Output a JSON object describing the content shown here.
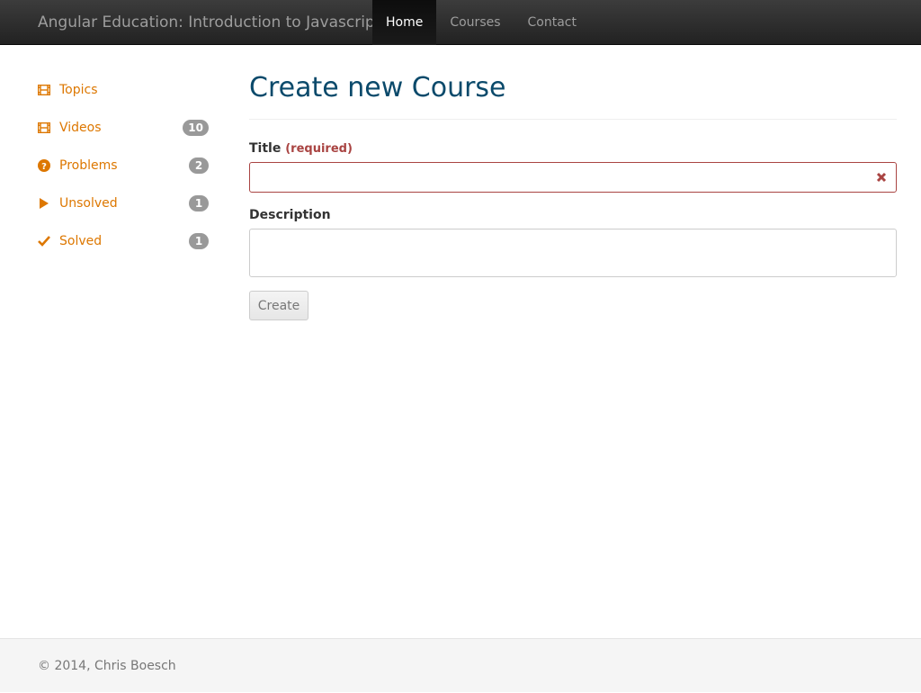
{
  "navbar": {
    "brand": "Angular Education: Introduction to Javascript",
    "items": [
      {
        "label": "Home",
        "active": true
      },
      {
        "label": "Courses",
        "active": false
      },
      {
        "label": "Contact",
        "active": false
      }
    ]
  },
  "sidebar": {
    "accent_color": "#dd7700",
    "items": [
      {
        "label": "Topics",
        "icon": "film-icon",
        "count": null
      },
      {
        "label": "Videos",
        "icon": "film-icon",
        "count": "10"
      },
      {
        "label": "Problems",
        "icon": "question-circle-icon",
        "count": "2"
      },
      {
        "label": "Unsolved",
        "icon": "play-icon",
        "count": "1"
      },
      {
        "label": "Solved",
        "icon": "check-icon",
        "count": "1"
      }
    ]
  },
  "main": {
    "title": "Create new Course",
    "form": {
      "title_label": "Title",
      "title_required": "(required)",
      "title_value": "",
      "description_label": "Description",
      "description_value": "",
      "submit_label": "Create"
    }
  },
  "footer": {
    "text": "© 2014, Chris Boesch"
  },
  "colors": {
    "title": "#0b4a6b",
    "error": "#a94442",
    "badge": "#999999"
  }
}
